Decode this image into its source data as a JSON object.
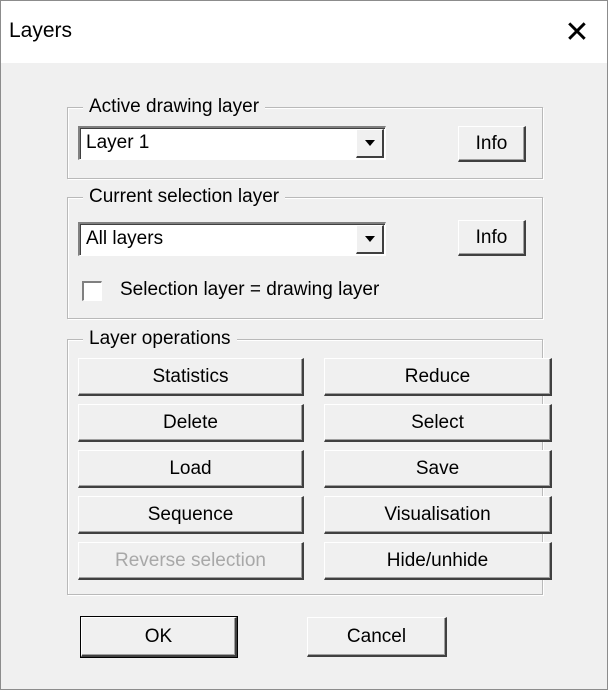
{
  "window": {
    "title": "Layers",
    "close_glyph": "✕"
  },
  "active_drawing_layer": {
    "label": "Active drawing layer",
    "selected": "Layer  1",
    "info_label": "Info"
  },
  "current_selection_layer": {
    "label": "Current selection layer",
    "selected": "All layers",
    "info_label": "Info",
    "checkbox_label": "Selection layer = drawing layer",
    "checkbox_checked": false
  },
  "layer_operations": {
    "label": "Layer operations",
    "buttons": [
      {
        "label": "Statistics",
        "enabled": true
      },
      {
        "label": "Reduce",
        "enabled": true
      },
      {
        "label": "Delete",
        "enabled": true
      },
      {
        "label": "Select",
        "enabled": true
      },
      {
        "label": "Load",
        "enabled": true
      },
      {
        "label": "Save",
        "enabled": true
      },
      {
        "label": "Sequence",
        "enabled": true
      },
      {
        "label": "Visualisation",
        "enabled": true
      },
      {
        "label": "Reverse selection",
        "enabled": false
      },
      {
        "label": "Hide/unhide",
        "enabled": true
      }
    ]
  },
  "footer": {
    "ok_label": "OK",
    "cancel_label": "Cancel"
  },
  "icons": {
    "close": "close-icon",
    "dropdown": "chevron-down-icon"
  }
}
